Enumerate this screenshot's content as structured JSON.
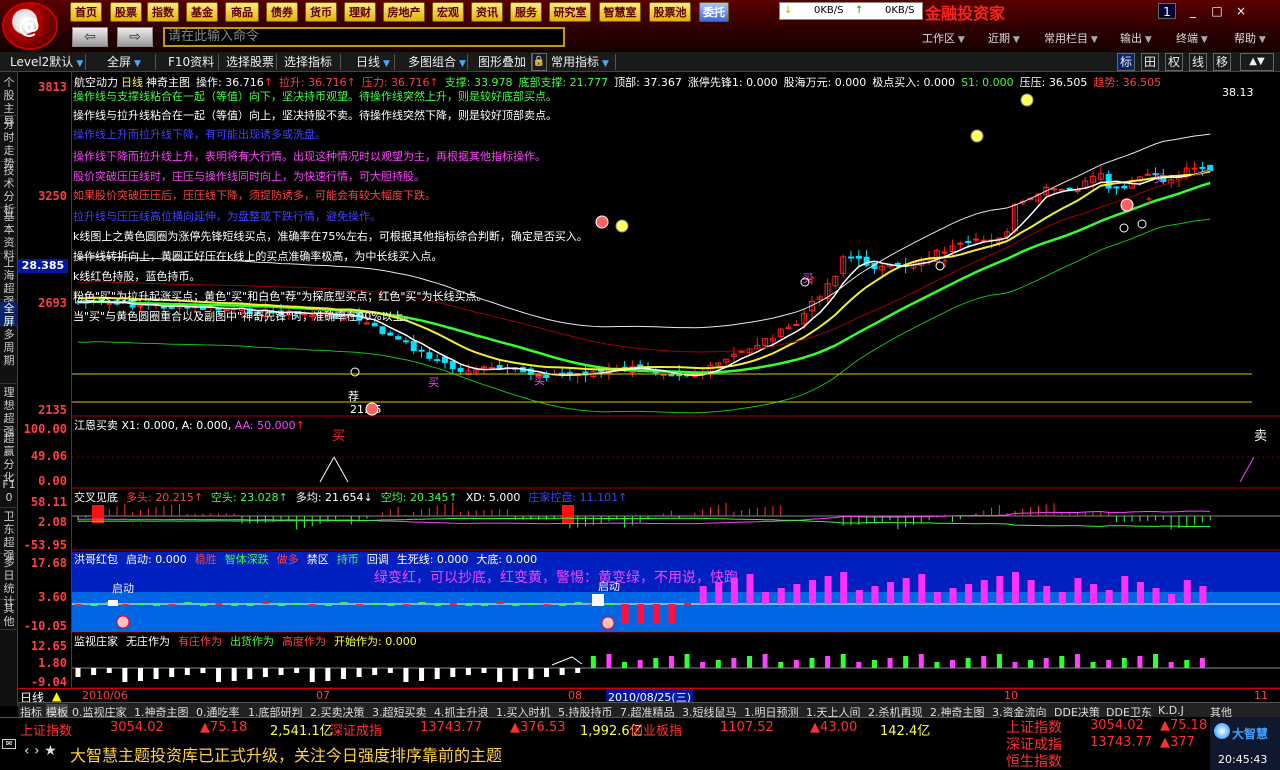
{
  "topbar": {
    "logo_glyph": "@",
    "menu": [
      "首页",
      "股票",
      "指数",
      "基金",
      "商品",
      "债券",
      "货币",
      "理财",
      "房地产",
      "宏观",
      "资讯",
      "服务",
      "研究室",
      "智慧室",
      "股票池",
      "委托"
    ],
    "active_menu": "委托",
    "speed": {
      "down_icon": "↓",
      "down": "0KB/S",
      "up_icon": "↑",
      "up": "0KB/S"
    },
    "brand": "金融投资家",
    "window_controls": {
      "help": "1",
      "minimize": "_",
      "restore": "□",
      "close": "×"
    },
    "back_glyph": "⇦",
    "forward_glyph": "⇨",
    "command_placeholder": "请在此输入命令",
    "right_menus": [
      "工作区",
      "近期",
      "常用栏目",
      "输出",
      "终端",
      "帮助"
    ]
  },
  "toolbar": {
    "items": [
      "Level2默认",
      "全屏",
      "F10资料",
      "选择股票",
      "选择指标",
      "日线",
      "多图组合",
      "图形叠加",
      "常用指标"
    ],
    "right_icons": [
      "标",
      "田",
      "权",
      "线",
      "移"
    ]
  },
  "left_tabs": [
    "个股主导",
    "分时走势",
    "技术分析",
    "基本资料",
    "上海超强",
    "全屏",
    "多周期",
    "理想超强",
    "超赢分化",
    "F10",
    "卫东超强",
    "多日统计",
    "其他"
  ],
  "active_left_tab": "全屏",
  "yaxis": {
    "main": [
      "3813",
      "3250",
      "2693",
      "2135"
    ],
    "price_badge": "28.385",
    "sub1": [
      "100.00",
      "49.06",
      "0.00"
    ],
    "sub2": [
      "58.11",
      "2.08",
      "-53.95"
    ],
    "sub3": [
      "17.68",
      "3.60",
      "-10.05"
    ],
    "sub4": [
      "12.65",
      "1.80",
      "-9.04"
    ]
  },
  "main_header": {
    "name": "航空动力",
    "period": "日线",
    "indicator": "神奇主图",
    "fields": [
      {
        "label": "操作: 36.716",
        "color": "#ffffff",
        "arrow": "↑"
      },
      {
        "label": "拉升: 36.716",
        "color": "#ff4040",
        "arrow": "↑"
      },
      {
        "label": "压力: 36.716",
        "color": "#ff4040",
        "arrow": "↑"
      },
      {
        "label": "支撑: 33.978",
        "color": "#40ff40",
        "arrow": ""
      },
      {
        "label": "底部支撑: 21.777",
        "color": "#40ff40",
        "arrow": ""
      },
      {
        "label": "顶部: 37.367",
        "color": "#ffffff",
        "arrow": ""
      },
      {
        "label": "涨停先锋1: 0.000",
        "color": "#ffffff",
        "arrow": ""
      },
      {
        "label": "股海万元: 0.000",
        "color": "#ffffff",
        "arrow": ""
      },
      {
        "label": "极点买入: 0.000",
        "color": "#ffffff",
        "arrow": ""
      },
      {
        "label": "S1: 0.000",
        "color": "#40ff40",
        "arrow": ""
      },
      {
        "label": "压压: 36.505",
        "color": "#ffffff",
        "arrow": ""
      },
      {
        "label": "趋势: 36.505",
        "color": "#ff4040",
        "arrow": ""
      }
    ],
    "lines": [
      {
        "text": "操作线与支撑线粘合在一起（等值）向下，坚决持币观望。待操作线突然上升，则是较好底部买点。",
        "color": "#40ff40"
      },
      {
        "text": "操作线与拉升线粘合在一起（等值）向上，坚决持股不卖。待操作线突然下降，则是较好顶部卖点。",
        "color": "#ffffff"
      },
      {
        "text": "操作线上升而拉升线下降，有可能出现诱多或洗盘。",
        "color": "#4040ff"
      },
      {
        "text": "操作线下降而拉升线上升，表明将有大行情。出现这种情况时以观望为主，再根据其他指标操作。",
        "color": "#ff40ff"
      },
      {
        "text": "股价突破压压线时，庄压与操作线同时向上，为快速行情，可大胆持股。",
        "color": "#ff40ff"
      },
      {
        "text": "如果股价突破压压后，压压线下降，须提防诱多，可能会有较大幅度下跌。",
        "color": "#ff4040"
      },
      {
        "text": "拉升线与压压线高位横向延伸，为盘整或下跌行情，避免操作。",
        "color": "#4040ff"
      },
      {
        "text": "k线图上之黄色圆圈为涨停先锋短线买点，准确率在75%左右，可根据其他指标综合判断，确定是否买入。",
        "color": "#ffffff"
      },
      {
        "text": "操作线转折向上，黄圈正好压在k线上的买点准确率极高，为中长线买入点。",
        "color": "#ffffff"
      },
      {
        "text": "k线红色持股，蓝色持币。",
        "color": "#ffffff"
      },
      {
        "text": "粉色\"买\"为拉升起涨买点；黄色\"买\"和白色\"荐\"为探底型买点；红色\"买\"为长线买点。",
        "color": "#ffffff"
      },
      {
        "text": "当\"买\"与黄色圆圈重合以及副图中\"神奇先锋\"时，准确率在90%以上。",
        "color": "#ffffff"
      }
    ]
  },
  "chart_labels": {
    "price_hi": "38.13",
    "price_lo": "21.35",
    "buy": "买",
    "sell": "卖",
    "rec": "荐",
    "launch": "启动",
    "top_label": "顶"
  },
  "sub1": {
    "name": "江恩买卖",
    "fields": "X1: 0.000, A: 0.000,",
    "aa": "AA: 50.000",
    "buy": "买",
    "sell": "卖"
  },
  "sub2": {
    "name": "交叉见底",
    "fields": [
      {
        "label": "多头: 20.215",
        "color": "#ff4040",
        "arrow": "↑"
      },
      {
        "label": "空头: 23.028",
        "color": "#40ff40",
        "arrow": "↑"
      },
      {
        "label": "多均: 21.654",
        "color": "#ffffff",
        "arrow": "↓"
      },
      {
        "label": "空均: 20.345",
        "color": "#40ff40",
        "arrow": "↑"
      },
      {
        "label": "XD: 5.000",
        "color": "#ffffff",
        "arrow": ""
      },
      {
        "label": "庄家控盘: 11.101",
        "color": "#4040ff",
        "arrow": "↑"
      }
    ]
  },
  "sub3": {
    "name": "洪哥红包",
    "fields": [
      {
        "label": "启动: 0.000",
        "color": "#ffffff"
      },
      {
        "label": "稳胜",
        "color": "#ff4040"
      },
      {
        "label": "智体深跌",
        "color": "#40ff40"
      },
      {
        "label": "做多",
        "color": "#ff4040"
      },
      {
        "label": "禁区",
        "color": "#ffffff"
      },
      {
        "label": "持币",
        "color": "#40ff40"
      },
      {
        "label": "回调",
        "color": "#ffffff"
      },
      {
        "label": "生死线: 0.000",
        "color": "#ffffff"
      },
      {
        "label": "大底: 0.000",
        "color": "#ffffff"
      }
    ],
    "banner": "绿变红，可以抄底，红变黄，警惕：黄变绿，不用说，快跑"
  },
  "sub4": {
    "name": "监视庄家",
    "fields": [
      {
        "label": "无庄作为",
        "color": "#ffffff"
      },
      {
        "label": "有庄作为",
        "color": "#ff4040"
      },
      {
        "label": "出货作为",
        "color": "#40ff40"
      },
      {
        "label": "高度作为",
        "color": "#ff4040"
      },
      {
        "label": "开始作为: 0.000",
        "color": "#ffff40"
      }
    ]
  },
  "dateaxis": {
    "period": "日线",
    "labels": [
      "2010/06",
      "07",
      "08",
      "10",
      "11"
    ],
    "cursor_date": "2010/08/25(三)"
  },
  "bottom_tabs": [
    "指标",
    "模板",
    "0.监视庄家",
    "1.神奇主图",
    "0.通吃率",
    "1.底部研判",
    "2.买卖决策",
    "3.超短买卖",
    "4.抓主升浪",
    "1.买入时机",
    "5.持股持币",
    "7.超准精品",
    "3.短线鼠马",
    "1.明日预测",
    "1.天上人间",
    "2.杀机再现",
    "2.神奇主图",
    "3.资金流向",
    "DDE决策",
    "DDE卫东",
    "K.D.J",
    "其他"
  ],
  "indexbar": [
    {
      "name": "上证指数",
      "val": "3054.02",
      "chg": "▲75.18",
      "amt": "2,541.1亿"
    },
    {
      "name": "深证成指",
      "val": "13743.77",
      "chg": "▲376.53",
      "amt": "1,992.6亿"
    },
    {
      "name": "创业板指",
      "val": "1107.52",
      "chg": "▲43.00",
      "amt": "142.4亿"
    }
  ],
  "news": "大智慧主题投资库已正式升级，关注今日强度排序靠前的主题",
  "right_panel": [
    {
      "name": "上证指数",
      "val": "3054.02",
      "chg": "▲75.18"
    },
    {
      "name": "深证成指",
      "val": "13743.77",
      "chg": "▲377"
    },
    {
      "name": "恒生指数",
      "val": "",
      "chg": ""
    }
  ],
  "clock": {
    "brand": "大智慧",
    "time": "20:45:43"
  },
  "colors": {
    "up": "#ff2020",
    "down": "#00e0ff",
    "ma_green": "#30ff30",
    "ma_yellow": "#f0f030",
    "ma_white": "#ffffff"
  }
}
